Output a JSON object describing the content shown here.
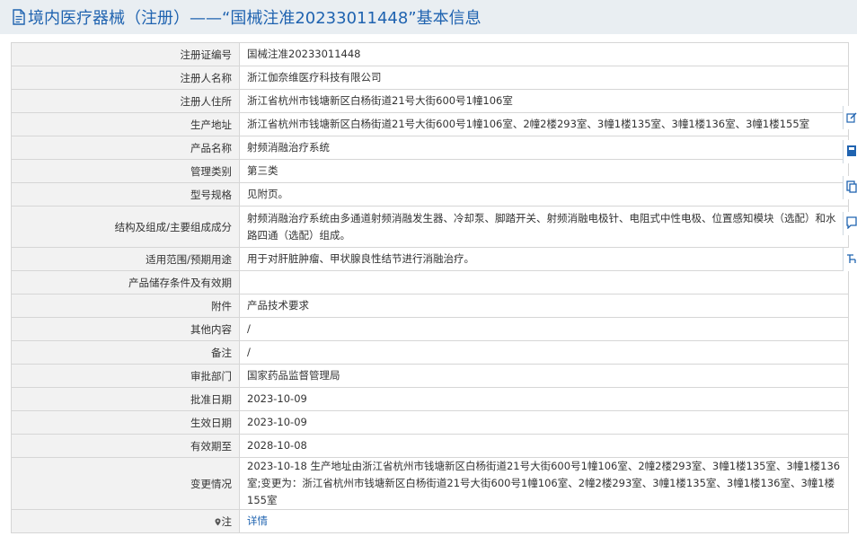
{
  "header": {
    "title": "境内医疗器械（注册）——“国械注准20233011448”基本信息",
    "icon": "document-icon"
  },
  "rows": [
    {
      "label": "注册证编号",
      "value": "国械注准20233011448"
    },
    {
      "label": "注册人名称",
      "value": "浙江伽奈维医疗科技有限公司"
    },
    {
      "label": "注册人住所",
      "value": "浙江省杭州市钱塘新区白杨街道21号大街600号1幢106室"
    },
    {
      "label": "生产地址",
      "value": "浙江省杭州市钱塘新区白杨街道21号大街600号1幢106室、2幢2楼293室、3幢1楼135室、3幢1楼136室、3幢1楼155室"
    },
    {
      "label": "产品名称",
      "value": "射频消融治疗系统"
    },
    {
      "label": "管理类别",
      "value": "第三类"
    },
    {
      "label": "型号规格",
      "value": "见附页。"
    },
    {
      "label": "结构及组成/主要组成成分",
      "value": "射频消融治疗系统由多通道射频消融发生器、冷却泵、脚踏开关、射频消融电极针、电阻式中性电极、位置感知模块（选配）和水路四通（选配）组成。"
    },
    {
      "label": "适用范围/预期用途",
      "value": "用于对肝脏肿瘤、甲状腺良性结节进行消融治疗。"
    },
    {
      "label": "产品储存条件及有效期",
      "value": ""
    },
    {
      "label": "附件",
      "value": "产品技术要求"
    },
    {
      "label": "其他内容",
      "value": "/"
    },
    {
      "label": "备注",
      "value": "/"
    },
    {
      "label": "审批部门",
      "value": "国家药品监督管理局"
    },
    {
      "label": "批准日期",
      "value": "2023-10-09"
    },
    {
      "label": "生效日期",
      "value": "2023-10-09"
    },
    {
      "label": "有效期至",
      "value": "2028-10-08"
    },
    {
      "label": "变更情况",
      "value": "2023-10-18 生产地址由浙江省杭州市钱塘新区白杨街道21号大街600号1幢106室、2幢2楼293室、3幢1楼135室、3幢1楼136室;变更为：浙江省杭州市钱塘新区白杨街道21号大街600号1幢106室、2幢2楼293室、3幢1楼135室、3幢1楼136室、3幢1楼155室"
    }
  ],
  "note": {
    "label": "注",
    "link": "详情",
    "icon": "pin-icon"
  },
  "side_buttons": [
    {
      "icon": "edit-icon"
    },
    {
      "icon": "bookmark-icon"
    },
    {
      "icon": "copy-icon"
    },
    {
      "icon": "feedback-icon"
    },
    {
      "icon": "share-icon"
    }
  ],
  "colors": {
    "accent": "#1f63b0",
    "header_bg": "#e9eef2",
    "label_bg": "#f2f2f2",
    "border": "#d6d6d6"
  }
}
